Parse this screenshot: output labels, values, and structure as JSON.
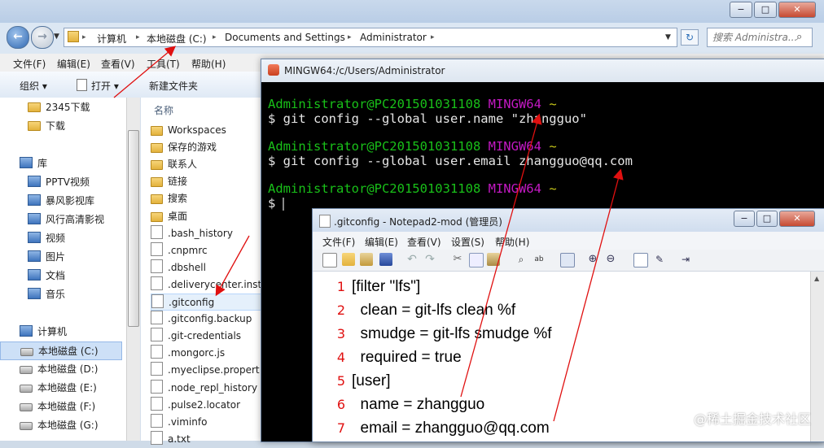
{
  "explorer": {
    "window_buttons": [
      "−",
      "□",
      "✕"
    ],
    "breadcrumbs": [
      "计算机",
      "本地磁盘 (C:)",
      "Documents and Settings",
      "Administrator"
    ],
    "search_placeholder": "搜索 Administra...",
    "menu": [
      "文件(F)",
      "编辑(E)",
      "查看(V)",
      "工具(T)",
      "帮助(H)"
    ],
    "toolbar": {
      "organize": "组织 ▾",
      "open": "打开 ▾",
      "new_folder": "新建文件夹"
    },
    "nav": {
      "items": [
        {
          "label": "2345下载",
          "icon": "folder"
        },
        {
          "label": "下载",
          "icon": "folder"
        },
        {
          "label": "",
          "icon": "none"
        },
        {
          "label": "库",
          "icon": "lib"
        },
        {
          "label": "PPTV视频",
          "icon": "lib"
        },
        {
          "label": "暴风影视库",
          "icon": "lib"
        },
        {
          "label": "风行高清影视",
          "icon": "lib"
        },
        {
          "label": "视频",
          "icon": "lib"
        },
        {
          "label": "图片",
          "icon": "lib"
        },
        {
          "label": "文档",
          "icon": "lib"
        },
        {
          "label": "音乐",
          "icon": "lib"
        },
        {
          "label": "",
          "icon": "none"
        },
        {
          "label": "计算机",
          "icon": "lib"
        },
        {
          "label": "本地磁盘 (C:)",
          "icon": "drive"
        },
        {
          "label": "本地磁盘 (D:)",
          "icon": "drive"
        },
        {
          "label": "本地磁盘 (E:)",
          "icon": "drive"
        },
        {
          "label": "本地磁盘 (F:)",
          "icon": "drive"
        },
        {
          "label": "本地磁盘 (G:)",
          "icon": "drive"
        }
      ],
      "selected_label": "本地磁盘 (C:)"
    },
    "files": {
      "column_header": "名称",
      "items": [
        {
          "label": "Workspaces",
          "icon": "folder"
        },
        {
          "label": "保存的游戏",
          "icon": "folder"
        },
        {
          "label": "联系人",
          "icon": "folder"
        },
        {
          "label": "链接",
          "icon": "folder"
        },
        {
          "label": "搜索",
          "icon": "folder"
        },
        {
          "label": "桌面",
          "icon": "folder"
        },
        {
          "label": ".bash_history",
          "icon": "file"
        },
        {
          "label": ".cnpmrc",
          "icon": "file"
        },
        {
          "label": ".dbshell",
          "icon": "file"
        },
        {
          "label": ".deliverycenter.inst",
          "icon": "file"
        },
        {
          "label": ".gitconfig",
          "icon": "file"
        },
        {
          "label": ".gitconfig.backup",
          "icon": "file"
        },
        {
          "label": ".git-credentials",
          "icon": "file"
        },
        {
          "label": ".mongorc.js",
          "icon": "file"
        },
        {
          "label": ".myeclipse.propert",
          "icon": "file"
        },
        {
          "label": ".node_repl_history",
          "icon": "file"
        },
        {
          "label": ".pulse2.locator",
          "icon": "file"
        },
        {
          "label": ".viminfo",
          "icon": "file"
        },
        {
          "label": "a.txt",
          "icon": "file"
        }
      ],
      "selected_label": ".gitconfig"
    }
  },
  "terminal": {
    "title": "MINGW64:/c/Users/Administrator",
    "window_buttons": [
      "−",
      "□",
      "✕"
    ],
    "prompt_user": "Administrator@PC201501031108",
    "prompt_env": "MINGW64",
    "prompt_path": "~",
    "commands": [
      "$ git config --global user.name \"zhangguo\"",
      "$ git config --global user.email zhangguo@qq.com",
      "$ "
    ]
  },
  "notepad": {
    "title": ".gitconfig - Notepad2-mod (管理员)",
    "window_buttons": [
      "−",
      "□",
      "✕"
    ],
    "menu": [
      "文件(F)",
      "编辑(E)",
      "查看(V)",
      "设置(S)",
      "帮助(H)"
    ],
    "line_numbers": [
      "1",
      "2",
      "3",
      "4",
      "5",
      "6",
      "7"
    ],
    "lines": [
      "[filter \"lfs\"]",
      "  clean = git-lfs clean %f",
      "  smudge = git-lfs smudge %f",
      "  required = true",
      "[user]",
      "  name = zhangguo",
      "  email = zhangguo@qq.com"
    ]
  },
  "watermark": "@稀土掘金技术社区",
  "colors": {
    "terminal_green": "#19c019",
    "terminal_magenta": "#c419c4",
    "terminal_yellow": "#c8c819",
    "arrow_red": "#e01010",
    "line_number_red": "#e01010"
  }
}
